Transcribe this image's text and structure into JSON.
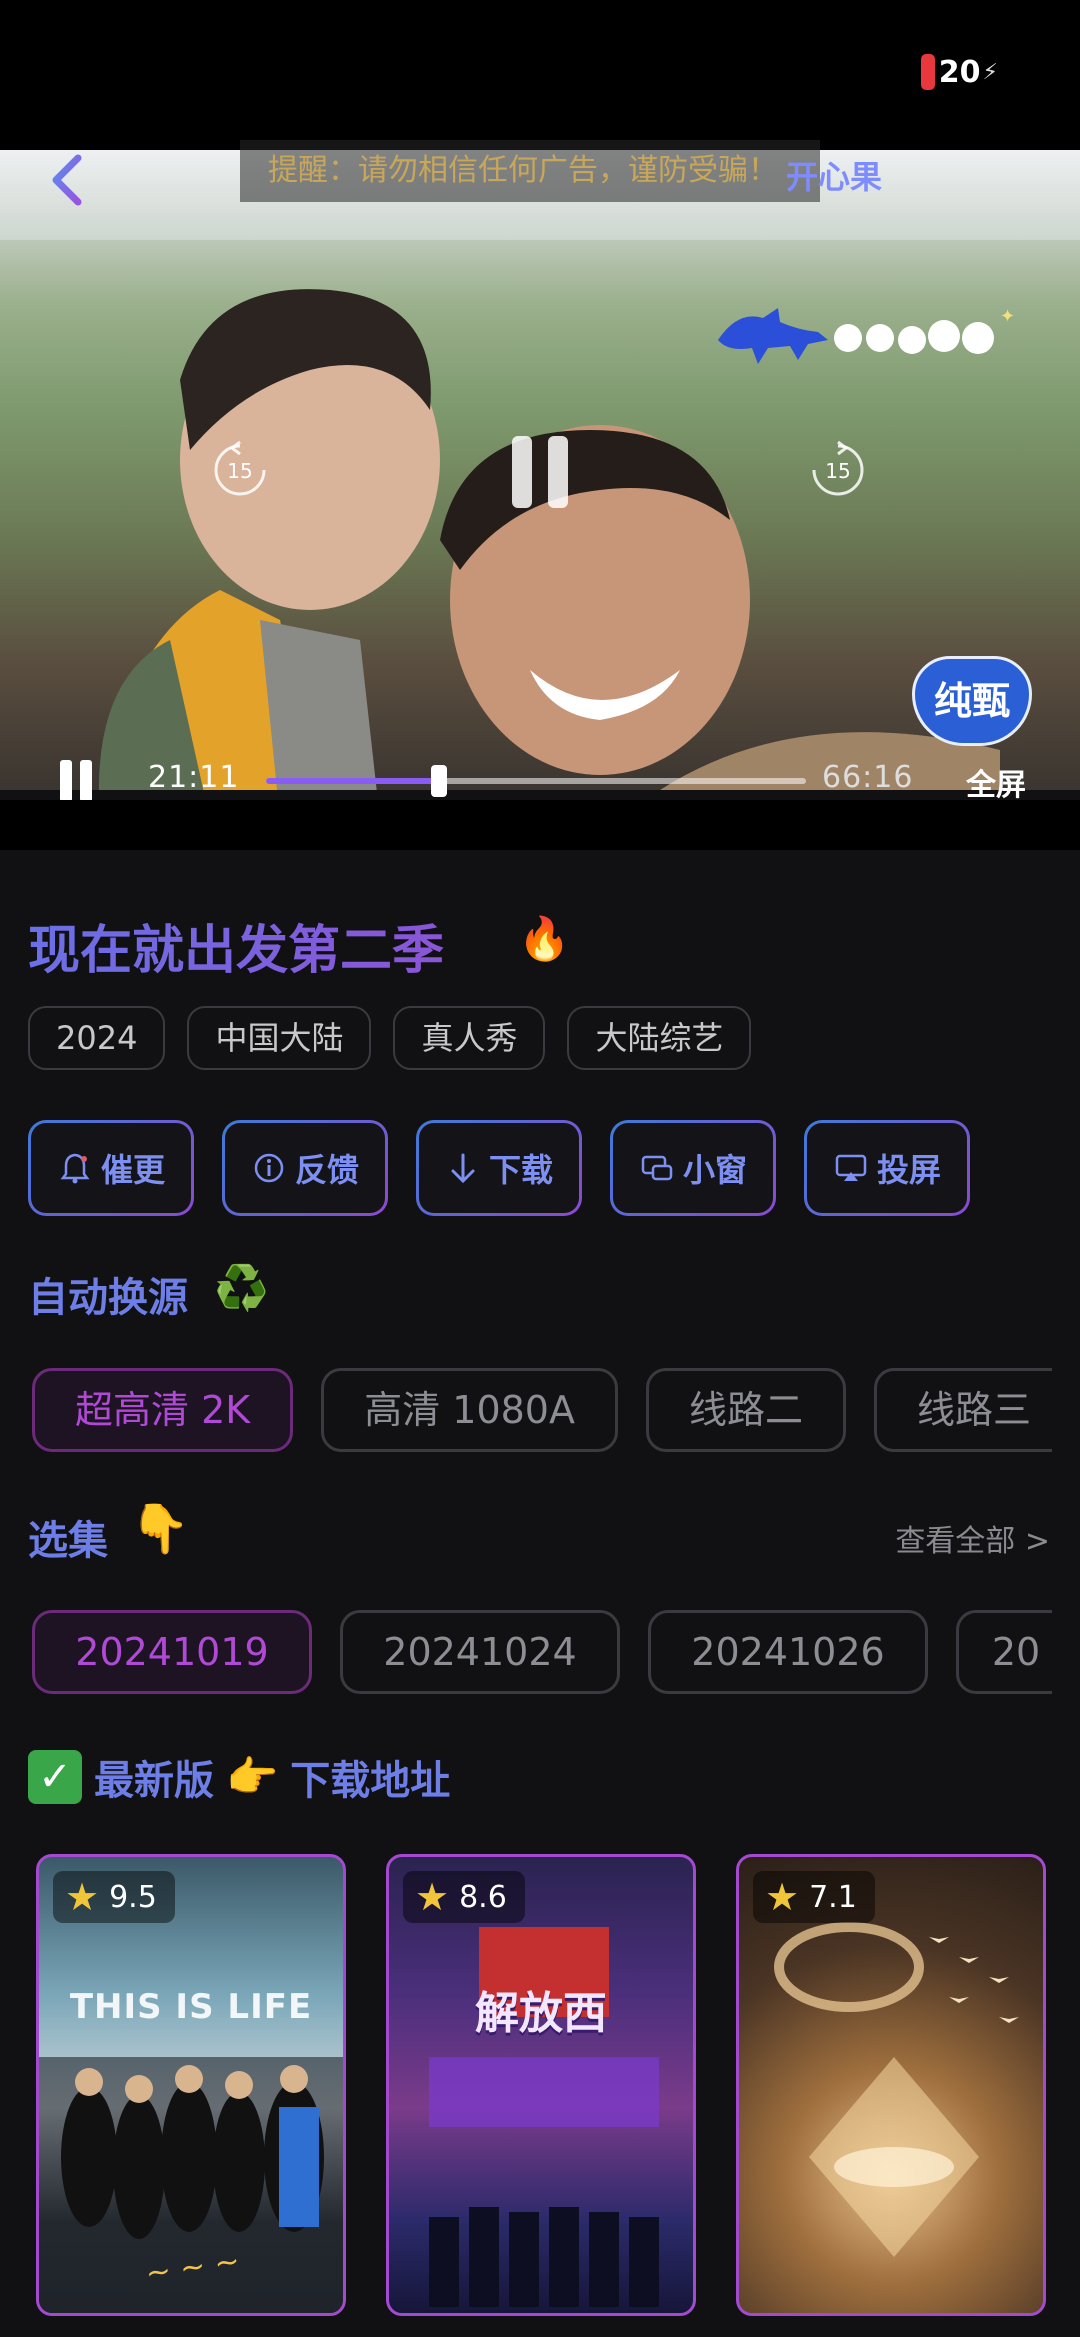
{
  "status": {
    "battery_level": "20"
  },
  "player": {
    "notice": "提醒：请勿相信任何广告，谨防受骗！",
    "source_name": "开心果",
    "brand_badge": "纯甄",
    "replay_back_seconds": "15",
    "replay_forward_seconds": "15",
    "current_time": "21:11",
    "total_time": "66:16",
    "progress": 0.32,
    "fullscreen_label": "全屏"
  },
  "show": {
    "title": "现在就出发第二季",
    "title_emoji": "🔥",
    "tags": [
      "2024",
      "中国大陆",
      "真人秀",
      "大陆综艺"
    ]
  },
  "actions": [
    {
      "label": "催更",
      "icon": "bell-icon"
    },
    {
      "label": "反馈",
      "icon": "info-icon"
    },
    {
      "label": "下载",
      "icon": "download-icon"
    },
    {
      "label": "小窗",
      "icon": "pip-icon"
    },
    {
      "label": "投屏",
      "icon": "cast-icon"
    }
  ],
  "sources_section": {
    "title": "自动换源",
    "emoji": "♻️",
    "sources": [
      "超高清 2K",
      "高清 1080A",
      "线路二",
      "线路三"
    ],
    "active_index": 0
  },
  "episodes_section": {
    "title": "选集",
    "emoji": "👇",
    "see_all": "查看全部 >",
    "episodes": [
      "20241019",
      "20241024",
      "20241026",
      "20"
    ],
    "active_index": 0
  },
  "download_section": {
    "check": "✓",
    "text1": "最新版",
    "emoji": "👉",
    "text2": "下载地址"
  },
  "recommendations": [
    {
      "rating": "9.5",
      "caption": "THIS IS LIFE"
    },
    {
      "rating": "8.6",
      "caption": "解放西"
    },
    {
      "rating": "7.1",
      "caption": ""
    }
  ],
  "colors": {
    "accent": "#6d7ee6",
    "active_pill": "#b04ad6",
    "badge": "#2a5fd6"
  }
}
